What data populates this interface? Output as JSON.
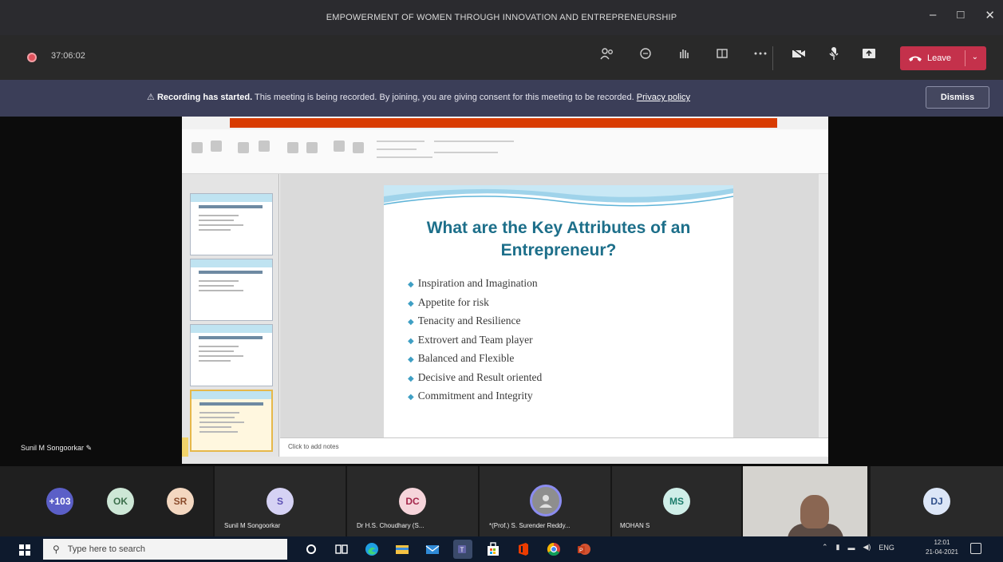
{
  "window": {
    "title": "EMPOWERMENT OF WOMEN THROUGH INNOVATION AND ENTREPRENEURSHIP",
    "controls": [
      "–",
      "□",
      "✕"
    ]
  },
  "meeting": {
    "timer": "37:06:02",
    "toolbar_icons": [
      "participants-icon",
      "chat-icon",
      "raise-hand-icon",
      "rooms-icon",
      "more-icon"
    ],
    "media_icons": [
      "camera-icon",
      "mic-icon",
      "share-icon"
    ],
    "leave_label": "Leave",
    "leave_color": "#c4314b"
  },
  "banner": {
    "bold": "Recording has started.",
    "text": " This meeting is being recorded. By joining, you are giving consent for this meeting to be recorded.",
    "link": "Privacy policy",
    "dismiss_label": "Dismiss"
  },
  "slide": {
    "title_line1": "What are the Key Attributes of an",
    "title_line2": "Entrepreneur?",
    "bullets": [
      "Inspiration and Imagination",
      "Appetite for risk",
      "Tenacity and Resilience",
      "Extrovert and Team player",
      "Balanced and Flexible",
      "Decisive and Result oriented",
      "Commitment and Integrity"
    ],
    "notes_placeholder": "Click to add notes",
    "title_color": "#1d6f8a"
  },
  "self_view": {
    "name": "Sunil M Songoorkar"
  },
  "participants": [
    {
      "initials": "+103",
      "color": "#5b5fc7",
      "text_color": "#fff",
      "name": ""
    },
    {
      "initials": "OK",
      "color": "#cde7d6",
      "text_color": "#3b6e4b",
      "name": ""
    },
    {
      "initials": "SR",
      "color": "#f3d7c0",
      "text_color": "#8a4b2b",
      "name": ""
    },
    {
      "initials": "S",
      "color": "#d5d2f4",
      "text_color": "#5b4fb3",
      "name": "Sunil M Songoorkar"
    },
    {
      "initials": "DC",
      "color": "#f6d5db",
      "text_color": "#a4264a",
      "name": "Dr H.S. Choudhary (S..."
    },
    {
      "initials": "",
      "color": "#8e8e8e",
      "text_color": "#fff",
      "name": "*(Prof.) S. Surender Reddy..."
    },
    {
      "initials": "MS",
      "color": "#cfeee8",
      "text_color": "#1c7c6b",
      "name": "MOHAN S"
    },
    {
      "initials": "DJ",
      "color": "#dce6f7",
      "text_color": "#2f4f8a",
      "name": ""
    }
  ],
  "taskbar": {
    "search_placeholder": "Type here to search",
    "apps": [
      "cortana-icon",
      "task-view-icon",
      "edge-icon",
      "file-explorer-icon",
      "mail-icon",
      "teams-icon",
      "store-icon",
      "office-icon",
      "chrome-icon",
      "powerpoint-icon"
    ],
    "language": "ENG",
    "time": "12:01",
    "date": "21-04-2021"
  }
}
